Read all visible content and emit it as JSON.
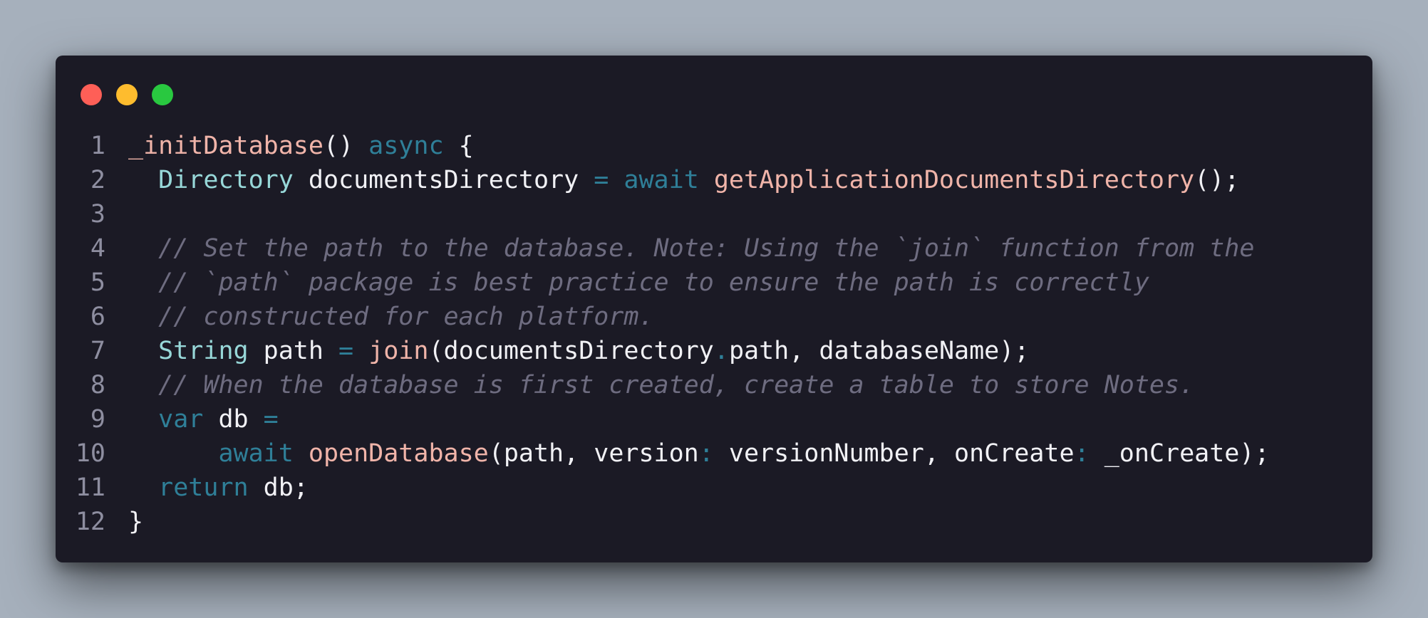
{
  "window": {
    "traffic_lights": [
      {
        "name": "close",
        "color": "#fe5f57"
      },
      {
        "name": "minimize",
        "color": "#febc2e"
      },
      {
        "name": "zoom",
        "color": "#29c840"
      }
    ]
  },
  "colors": {
    "background": "#a6b0bc",
    "editor": "#1b1a25",
    "keyword": "#2f7f98",
    "type": "#97d7d8",
    "function": "#f0b4a9",
    "comment": "#6e6c80",
    "text": "#f1f1f5"
  },
  "code": {
    "lines": [
      {
        "number": "1",
        "tokens": [
          {
            "t": "_initDatabase",
            "k": "func"
          },
          {
            "t": "() ",
            "k": "plain"
          },
          {
            "t": "async",
            "k": "keyword"
          },
          {
            "t": " {",
            "k": "plain"
          }
        ]
      },
      {
        "number": "2",
        "tokens": [
          {
            "t": "  ",
            "k": "plain"
          },
          {
            "t": "Directory",
            "k": "type"
          },
          {
            "t": " documentsDirectory ",
            "k": "plain"
          },
          {
            "t": "=",
            "k": "op"
          },
          {
            "t": " ",
            "k": "plain"
          },
          {
            "t": "await",
            "k": "keyword"
          },
          {
            "t": " ",
            "k": "plain"
          },
          {
            "t": "getApplicationDocumentsDirectory",
            "k": "func"
          },
          {
            "t": "();",
            "k": "plain"
          }
        ]
      },
      {
        "number": "3",
        "tokens": []
      },
      {
        "number": "4",
        "tokens": [
          {
            "t": "  ",
            "k": "plain"
          },
          {
            "t": "// Set the path to the database. Note: Using the `join` function from the",
            "k": "comment"
          }
        ]
      },
      {
        "number": "5",
        "tokens": [
          {
            "t": "  ",
            "k": "plain"
          },
          {
            "t": "// `path` package is best practice to ensure the path is correctly",
            "k": "comment"
          }
        ]
      },
      {
        "number": "6",
        "tokens": [
          {
            "t": "  ",
            "k": "plain"
          },
          {
            "t": "// constructed for each platform.",
            "k": "comment"
          }
        ]
      },
      {
        "number": "7",
        "tokens": [
          {
            "t": "  ",
            "k": "plain"
          },
          {
            "t": "String",
            "k": "type"
          },
          {
            "t": " path ",
            "k": "plain"
          },
          {
            "t": "=",
            "k": "op"
          },
          {
            "t": " ",
            "k": "plain"
          },
          {
            "t": "join",
            "k": "func"
          },
          {
            "t": "(documentsDirectory",
            "k": "plain"
          },
          {
            "t": ".",
            "k": "op"
          },
          {
            "t": "path, databaseName);",
            "k": "plain"
          }
        ]
      },
      {
        "number": "8",
        "tokens": [
          {
            "t": "  ",
            "k": "plain"
          },
          {
            "t": "// When the database is first created, create a table to store Notes.",
            "k": "comment"
          }
        ]
      },
      {
        "number": "9",
        "tokens": [
          {
            "t": "  ",
            "k": "plain"
          },
          {
            "t": "var",
            "k": "keyword"
          },
          {
            "t": " db ",
            "k": "plain"
          },
          {
            "t": "=",
            "k": "op"
          }
        ]
      },
      {
        "number": "10",
        "tokens": [
          {
            "t": "      ",
            "k": "plain"
          },
          {
            "t": "await",
            "k": "keyword"
          },
          {
            "t": " ",
            "k": "plain"
          },
          {
            "t": "openDatabase",
            "k": "func"
          },
          {
            "t": "(path, version",
            "k": "plain"
          },
          {
            "t": ":",
            "k": "op"
          },
          {
            "t": " versionNumber, onCreate",
            "k": "plain"
          },
          {
            "t": ":",
            "k": "op"
          },
          {
            "t": " _onCreate);",
            "k": "plain"
          }
        ]
      },
      {
        "number": "11",
        "tokens": [
          {
            "t": "  ",
            "k": "plain"
          },
          {
            "t": "return",
            "k": "keyword"
          },
          {
            "t": " db;",
            "k": "plain"
          }
        ]
      },
      {
        "number": "12",
        "tokens": [
          {
            "t": "}",
            "k": "plain"
          }
        ]
      }
    ]
  }
}
